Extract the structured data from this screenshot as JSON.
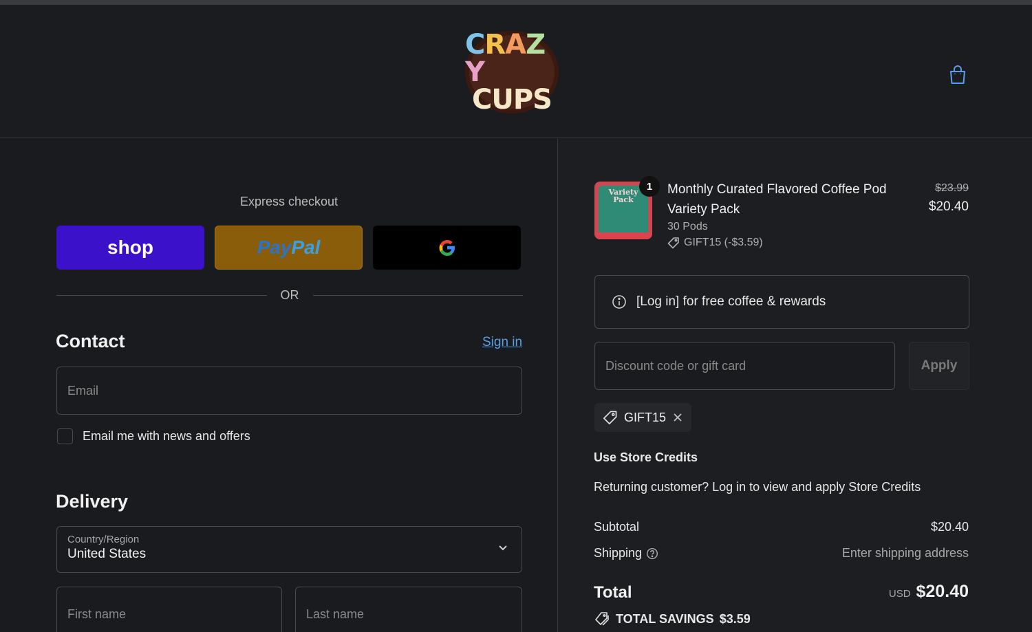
{
  "brand": {
    "logo_line1": "CRAZY",
    "logo_line2": "CUPS",
    "logo_colors": [
      "#e8a0c8",
      "#f2c14e",
      "#7fc4e8",
      "#f29b5c",
      "#b6e0a0"
    ]
  },
  "header": {
    "cart_icon": "shopping-bag-icon"
  },
  "express": {
    "label": "Express checkout",
    "shop_label": "shop",
    "paypal_part1": "Pay",
    "paypal_part2": "Pal",
    "google_label": "G",
    "or_label": "OR"
  },
  "contact": {
    "title": "Contact",
    "sign_in": "Sign in",
    "email_placeholder": "Email",
    "newsletter_label": "Email me with news and offers"
  },
  "delivery": {
    "title": "Delivery",
    "country_label": "Country/Region",
    "country_value": "United States",
    "first_name_placeholder": "First name",
    "last_name_placeholder": "Last name"
  },
  "order": {
    "quantity": "1",
    "thumb_text": "Variety Pack",
    "product_name": "Monthly Curated Flavored Coffee Pod Variety Pack",
    "variant": "30 Pods",
    "discount_line": "GIFT15 (-$3.59)",
    "old_price": "$23.99",
    "price": "$20.40"
  },
  "login_banner": "[Log in] for free coffee & rewards",
  "discount": {
    "placeholder": "Discount code or gift card",
    "apply_label": "Apply",
    "applied_code": "GIFT15"
  },
  "store_credits": {
    "title": "Use Store Credits",
    "text": "Returning customer? Log in to view and apply Store Credits"
  },
  "summary": {
    "subtotal_label": "Subtotal",
    "subtotal_value": "$20.40",
    "shipping_label": "Shipping",
    "shipping_value": "Enter shipping address",
    "total_label": "Total",
    "currency": "USD",
    "total_value": "$20.40",
    "savings_label": "TOTAL SAVINGS",
    "savings_value": "$3.59"
  },
  "colors": {
    "background": "#1a1b1e",
    "shop_pay": "#3b12c9",
    "paypal": "#8a5d0a",
    "link": "#5b9ee6"
  }
}
